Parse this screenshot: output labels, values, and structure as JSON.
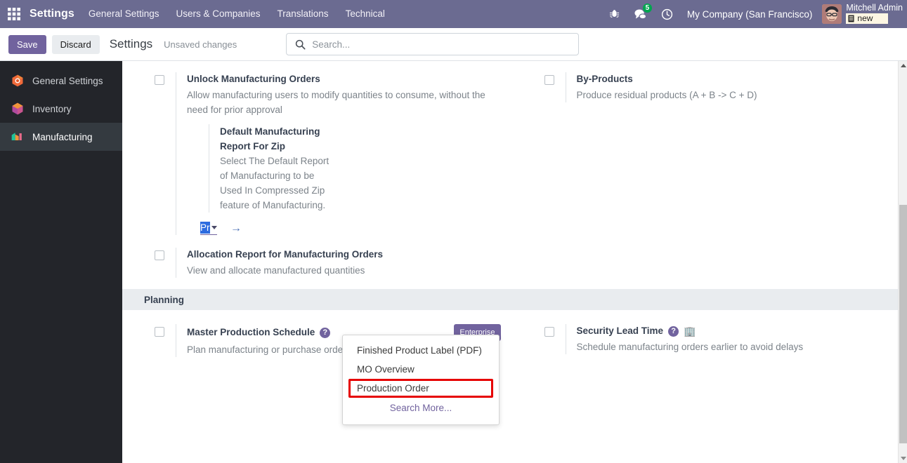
{
  "navbar": {
    "apps_icon": "apps-grid-icon",
    "brand": "Settings",
    "menu_items": [
      {
        "label": "General Settings"
      },
      {
        "label": "Users & Companies"
      },
      {
        "label": "Translations"
      },
      {
        "label": "Technical"
      }
    ],
    "debug_icon": "bug-icon",
    "messages_icon": "chat-bubbles-icon",
    "messages_count": "5",
    "activity_icon": "clock-icon",
    "company": "My Company (San Francisco)",
    "avatar_icon": "user-avatar",
    "user_name": "Mitchell Admin",
    "database_icon": "database-icon",
    "database_name": "new"
  },
  "control_panel": {
    "save_label": "Save",
    "discard_label": "Discard",
    "title": "Settings",
    "status": "Unsaved changes",
    "search_icon": "search-icon",
    "search_value": "",
    "search_placeholder": "Search..."
  },
  "sidebar": {
    "items": [
      {
        "label": "General Settings",
        "icon": "settings-app-icon",
        "active": false
      },
      {
        "label": "Inventory",
        "icon": "inventory-app-icon",
        "active": false
      },
      {
        "label": "Manufacturing",
        "icon": "manufacturing-app-icon",
        "active": true
      }
    ]
  },
  "settings": {
    "operations": [
      {
        "title": "Unlock Manufacturing Orders",
        "desc": "Allow manufacturing users to modify quantities to consume, without the need for prior approval",
        "checked": false
      },
      {
        "title": "By-Products",
        "desc": "Produce residual products (A + B -> C + D)",
        "checked": false
      },
      {
        "title": "Allocation Report for Manufacturing Orders",
        "desc": "View and allocate manufactured quantities",
        "checked": false
      }
    ],
    "sub_setting": {
      "title": "Default Manufacturing Report For Zip",
      "desc": "Select The Default Report of Manufacturing to be Used In Compressed Zip feature of Manufacturing.",
      "field_value": "Pr",
      "caret_icon": "chevron-down-icon",
      "internal_link_icon": "arrow-right-icon"
    },
    "dropdown": {
      "options": [
        {
          "label": "Finished Product Label (PDF)",
          "highlighted": false
        },
        {
          "label": "MO Overview",
          "highlighted": false
        },
        {
          "label": "Production Order",
          "highlighted": true
        }
      ],
      "search_more_label": "Search More..."
    },
    "planning": {
      "section_title": "Planning",
      "items": [
        {
          "title": "Master Production Schedule",
          "desc": "Plan manufacturing or purchase orders based on forecasts",
          "help_icon": "question-mark-icon",
          "badge": "Enterprise",
          "checked": false
        },
        {
          "title": "Security Lead Time",
          "desc": "Schedule manufacturing orders earlier to avoid delays",
          "help_icon": "question-mark-icon",
          "company_icon": "company-building-icon",
          "checked": false
        }
      ]
    }
  },
  "scrollbar": {
    "up_icon": "scroll-up-arrow-icon",
    "down_icon": "scroll-down-arrow-icon"
  },
  "colors": {
    "navbar_bg": "#6b6b91",
    "primary": "#71639e",
    "sidebar_bg": "#23252a",
    "highlight_red": "#e60000",
    "selection_blue": "#2d6cdf",
    "badge_green": "#00a54f"
  }
}
